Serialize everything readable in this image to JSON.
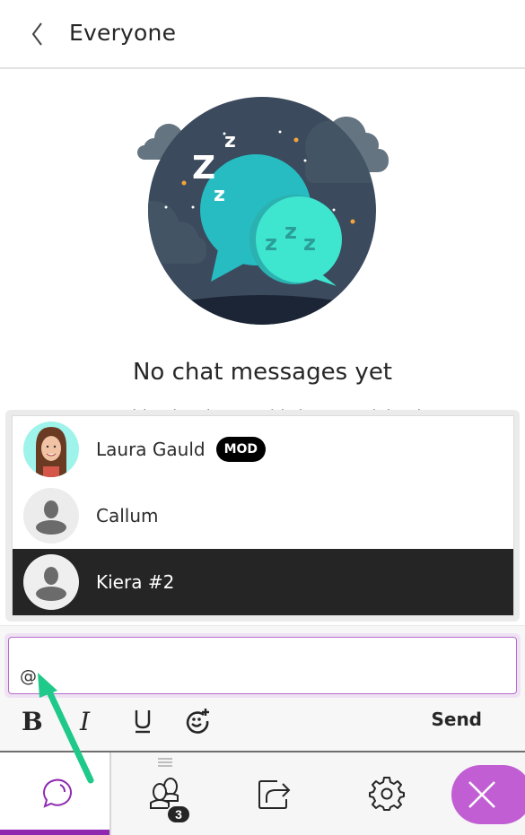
{
  "header": {
    "title": "Everyone",
    "back_icon": "chevron-left-icon"
  },
  "empty_state": {
    "illustration": "sleeping-chat-bubbles-illustration",
    "title": "No chat messages yet",
    "subtitle": "Nothing has been said since you joined"
  },
  "mention_popup": {
    "items": [
      {
        "name": "Laura Gauld",
        "badge": "MOD",
        "avatar": "photo",
        "selected": false
      },
      {
        "name": "Callum",
        "badge": "",
        "avatar": "default-user-icon",
        "selected": false
      },
      {
        "name": "Kiera #2",
        "badge": "",
        "avatar": "default-user-icon",
        "selected": true
      }
    ]
  },
  "composer": {
    "input_value": "@",
    "format_buttons": [
      {
        "name": "bold",
        "icon": "bold-icon"
      },
      {
        "name": "italic",
        "icon": "italic-icon"
      },
      {
        "name": "underline",
        "icon": "underline-icon"
      },
      {
        "name": "emoji",
        "icon": "emoji-add-icon"
      }
    ],
    "send_label": "Send"
  },
  "bottom_nav": {
    "tabs": [
      {
        "name": "chat",
        "icon": "chat-bubble-icon",
        "active": true
      },
      {
        "name": "attendees",
        "icon": "people-icon",
        "badge": "3",
        "active": false
      },
      {
        "name": "share-content",
        "icon": "share-icon",
        "active": false
      },
      {
        "name": "settings",
        "icon": "gear-icon",
        "active": false
      }
    ],
    "close_icon": "close-icon"
  },
  "colors": {
    "accent_purple": "#8f2ab0",
    "close_button": "#c15ed3",
    "input_border": "#b56ccc",
    "selected_row": "#252525",
    "annotation_arrow": "#1ec98a"
  }
}
